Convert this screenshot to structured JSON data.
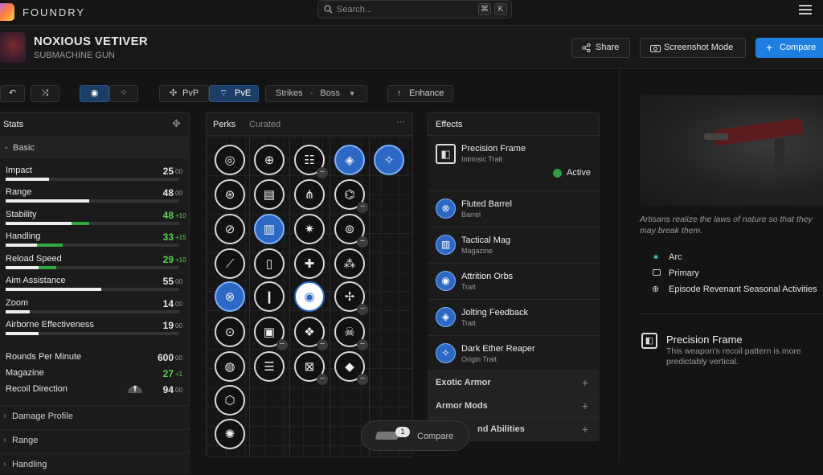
{
  "app": {
    "brand": "FOUNDRY"
  },
  "search": {
    "placeholder": "Search...",
    "kbd1": "⌘",
    "kbd2": "K"
  },
  "weapon": {
    "name": "NOXIOUS VETIVER",
    "type": "SUBMACHINE GUN"
  },
  "header_buttons": {
    "share": "Share",
    "screenshot": "Screenshot Mode",
    "compare": "Compare"
  },
  "toolbar": {
    "pvp": "PvP",
    "pve": "PvE",
    "activity": "Strikes",
    "activity_sep": "-",
    "activity_sub": "Boss",
    "enhance": "Enhance"
  },
  "stats_panel": {
    "title": "Stats",
    "basic_label": "Basic",
    "bar_stats": [
      {
        "name": "Impact",
        "value": "25",
        "bonus": "00",
        "fill": 25,
        "extra": 0
      },
      {
        "name": "Range",
        "value": "48",
        "bonus": "00",
        "fill": 48,
        "extra": 0
      },
      {
        "name": "Stability",
        "value": "48",
        "bonus": "+10",
        "fill": 38,
        "extra": 10,
        "boosted": true
      },
      {
        "name": "Handling",
        "value": "33",
        "bonus": "+15",
        "fill": 18,
        "extra": 15,
        "boosted": true
      },
      {
        "name": "Reload Speed",
        "value": "29",
        "bonus": "+10",
        "fill": 19,
        "extra": 10,
        "boosted": true
      },
      {
        "name": "Aim Assistance",
        "value": "55",
        "bonus": "00",
        "fill": 55,
        "extra": 0
      },
      {
        "name": "Zoom",
        "value": "14",
        "bonus": "00",
        "fill": 14,
        "extra": 0
      },
      {
        "name": "Airborne Effectiveness",
        "value": "19",
        "bonus": "00",
        "fill": 19,
        "extra": 0
      }
    ],
    "rpm": {
      "name": "Rounds Per Minute",
      "value": "600",
      "bonus": "00"
    },
    "magazine": {
      "name": "Magazine",
      "value": "27",
      "bonus": "+1"
    },
    "recoil": {
      "name": "Recoil Direction",
      "value": "94",
      "bonus": "00"
    },
    "sections": [
      "Damage Profile",
      "Range",
      "Handling"
    ]
  },
  "perks_panel": {
    "tab_perks": "Perks",
    "tab_curated": "Curated",
    "more": "···"
  },
  "effects_panel": {
    "title": "Effects",
    "intrinsic": {
      "name": "Precision Frame",
      "sub": "Intrinsic Trait",
      "status": "Active"
    },
    "items": [
      {
        "name": "Fluted Barrel",
        "sub": "Barrel"
      },
      {
        "name": "Tactical Mag",
        "sub": "Magazine"
      },
      {
        "name": "Attrition Orbs",
        "sub": "Trait"
      },
      {
        "name": "Jolting Feedback",
        "sub": "Trait"
      },
      {
        "name": "Dark Ether Reaper",
        "sub": "Origin Trait"
      }
    ],
    "sections": [
      "Exotic Armor",
      "Armor Mods",
      "nd Abilities"
    ]
  },
  "compare_float": {
    "count": "1",
    "label": "Compare"
  },
  "details": {
    "flavor": "Artisans realize the laws of nature so that they may break them.",
    "element": "Arc",
    "slot": "Primary",
    "source": "Episode Revenant Seasonal Activities",
    "frame_title": "Precision Frame",
    "frame_desc": "This weapon's recoil pattern is more predictably vertical."
  },
  "colors": {
    "accent": "#1f7fe0",
    "selected_perk": "#2d69c4",
    "bonus_green": "#2faa3f",
    "active_dot": "#2f9e44"
  }
}
